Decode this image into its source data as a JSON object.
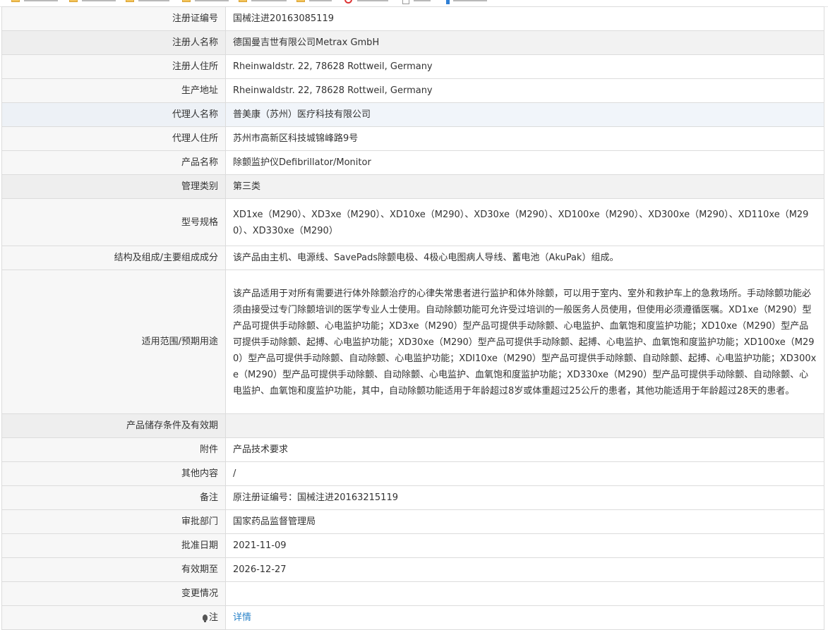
{
  "rows": [
    {
      "label": "注册证编号",
      "value": "国械注进20163085119"
    },
    {
      "label": "注册人名称",
      "value": "德国曼吉世有限公司Metrax GmbH"
    },
    {
      "label": "注册人住所",
      "value": "Rheinwaldstr. 22, 78628 Rottweil, Germany"
    },
    {
      "label": "生产地址",
      "value": "Rheinwaldstr. 22, 78628 Rottweil, Germany"
    },
    {
      "label": "代理人名称",
      "value": "普美康（苏州）医疗科技有限公司"
    },
    {
      "label": "代理人住所",
      "value": "苏州市高新区科技城锦峰路9号"
    },
    {
      "label": "产品名称",
      "value": "除颤监护仪Defibrillator/Monitor"
    },
    {
      "label": "管理类别",
      "value": "第三类"
    },
    {
      "label": "型号规格",
      "value": "XD1xe（M290）、XD3xe（M290）、XD10xe（M290）、XD30xe（M290）、XD100xe（M290）、XD300xe（M290）、XD110xe（M290）、XD330xe（M290）"
    },
    {
      "label": "结构及组成/主要组成成分",
      "value": "该产品由主机、电源线、SavePads除颤电极、4极心电图病人导线、蓄电池（AkuPak）组成。"
    },
    {
      "label": "适用范围/预期用途",
      "value": "该产品适用于对所有需要进行体外除颤治疗的心律失常患者进行监护和体外除颤，可以用于室内、室外和救护车上的急救场所。手动除颤功能必须由接受过专门除颤培训的医学专业人士使用。自动除颤功能可允许受过培训的一般医务人员使用，但使用必须遵循医嘱。XD1xe（M290）型产品可提供手动除颤、心电监护功能；XD3xe（M290）型产品可提供手动除颤、心电监护、血氧饱和度监护功能；XD10xe（M290）型产品可提供手动除颤、起搏、心电监护功能；XD30xe（M290）型产品可提供手动除颤、起搏、心电监护、血氧饱和度监护功能；XD100xe（M290）型产品可提供手动除颤、自动除颤、心电监护功能；XDI10xe（M290）型产品可提供手动除颤、自动除颤、起搏、心电监护功能；XD300xe（M290）型产品可提供手动除颤、自动除颤、心电监护、血氧饱和度监护功能；XD330xe（M290）型产品可提供手动除颤、自动除颤、心电监护、血氧饱和度监护功能，其中，自动除颤功能适用于年龄超过8岁或体重超过25公斤的患者，其他功能适用于年龄超过28天的患者。"
    },
    {
      "label": "产品储存条件及有效期",
      "value": ""
    },
    {
      "label": "附件",
      "value": "产品技术要求"
    },
    {
      "label": "其他内容",
      "value": "/"
    },
    {
      "label": "备注",
      "value": "原注册证编号：国械注进20163215119"
    },
    {
      "label": "审批部门",
      "value": "国家药品监督管理局"
    },
    {
      "label": "批准日期",
      "value": "2021-11-09"
    },
    {
      "label": "有效期至",
      "value": "2026-12-27"
    },
    {
      "label": "变更情况",
      "value": ""
    },
    {
      "label": "注",
      "value": "详情"
    }
  ],
  "colors": {
    "link": "#2a83c9",
    "border": "#dcdcdc",
    "label_bg": "#f7f7f7",
    "highlight_bg": "#f1f5fa"
  },
  "icons": {
    "note": "bulb-icon"
  }
}
